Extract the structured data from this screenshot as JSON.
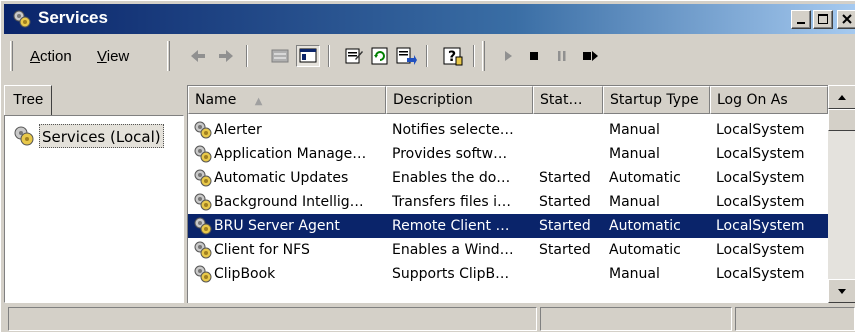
{
  "window": {
    "title": "Services",
    "icon": "services-gears-icon"
  },
  "title_buttons": {
    "minimize": "minimize-icon",
    "maximize": "maximize-icon",
    "close": "close-icon"
  },
  "menu": {
    "items": [
      {
        "label_prefix": "",
        "label_underlined": "A",
        "label_rest": "ction"
      },
      {
        "label_prefix": "",
        "label_underlined": "V",
        "label_rest": "iew"
      }
    ]
  },
  "toolbar": {
    "icons": [
      "back-arrow-icon",
      "forward-arrow-icon",
      "up-folder-icon",
      "show-hide-tree-icon",
      "properties-icon",
      "refresh-icon",
      "export-list-icon",
      "help-icon",
      "start-service-icon",
      "stop-service-icon",
      "pause-service-icon",
      "restart-service-icon"
    ]
  },
  "tree": {
    "tab_label": "Tree",
    "node_label": "Services (Local)"
  },
  "list": {
    "columns": [
      "Name",
      "Description",
      "Stat…",
      "Startup Type",
      "Log On As"
    ],
    "sort_indicator": "▲",
    "rows": [
      {
        "name": "Alerter",
        "description": "Notifies selecte…",
        "status": "",
        "startup": "Manual",
        "logon": "LocalSystem",
        "selected": false
      },
      {
        "name": "Application Manage…",
        "description": "Provides softw…",
        "status": "",
        "startup": "Manual",
        "logon": "LocalSystem",
        "selected": false
      },
      {
        "name": "Automatic Updates",
        "description": "Enables the do…",
        "status": "Started",
        "startup": "Automatic",
        "logon": "LocalSystem",
        "selected": false
      },
      {
        "name": "Background Intellig…",
        "description": "Transfers files i…",
        "status": "Started",
        "startup": "Manual",
        "logon": "LocalSystem",
        "selected": false
      },
      {
        "name": "BRU Server Agent",
        "description": "Remote Client …",
        "status": "Started",
        "startup": "Automatic",
        "logon": "LocalSystem",
        "selected": true
      },
      {
        "name": "Client for NFS",
        "description": "Enables a Wind…",
        "status": "Started",
        "startup": "Automatic",
        "logon": "LocalSystem",
        "selected": false
      },
      {
        "name": "ClipBook",
        "description": "Supports ClipB…",
        "status": "",
        "startup": "Manual",
        "logon": "LocalSystem",
        "selected": false
      }
    ]
  },
  "colors": {
    "selection": "#0a246a",
    "face": "#d4d0c8"
  }
}
